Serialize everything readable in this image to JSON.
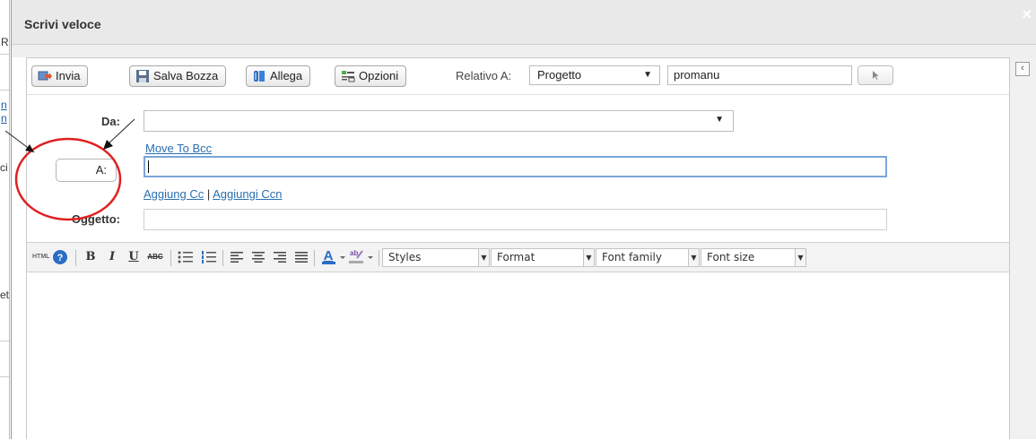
{
  "background_fragments": [
    "R",
    "n",
    "n",
    "ci",
    "et"
  ],
  "dialog": {
    "title": "Scrivi veloce",
    "close_glyph": "×"
  },
  "toolbar": {
    "send_label": "Invia",
    "save_draft_label": "Salva Bozza",
    "attach_label": "Allega",
    "options_label": "Opzioni",
    "related_label": "Relativo A:",
    "related_type_value": "Progetto",
    "related_value": "promanu"
  },
  "form": {
    "from_label": "Da:",
    "from_value": "",
    "move_to_bcc": "Move To Bcc",
    "to_button_label": "A:",
    "to_value": "",
    "add_cc": "Aggiung Cc",
    "separator": "|",
    "add_bcc": "Aggiungi Ccn",
    "subject_label": "Oggetto:",
    "subject_value": ""
  },
  "editor_toolbar": {
    "html_label": "HTML",
    "bold": "B",
    "italic": "I",
    "underline": "U",
    "strikethrough": "ABC",
    "styles": "Styles",
    "format": "Format",
    "font_family": "Font family",
    "font_size": "Font size"
  },
  "icons": [
    "send-icon",
    "save-icon",
    "attach-icon",
    "options-icon",
    "pointer-icon",
    "help-icon",
    "bullet-list-icon",
    "numbered-list-icon",
    "align-left-icon",
    "align-center-icon",
    "align-right-icon",
    "justify-icon",
    "font-color-icon",
    "highlight-icon",
    "collapse-icon"
  ],
  "colors": {
    "link": "#2a6fb0",
    "annotation_circle": "#e02020",
    "focus_border": "#7aa6d8"
  }
}
